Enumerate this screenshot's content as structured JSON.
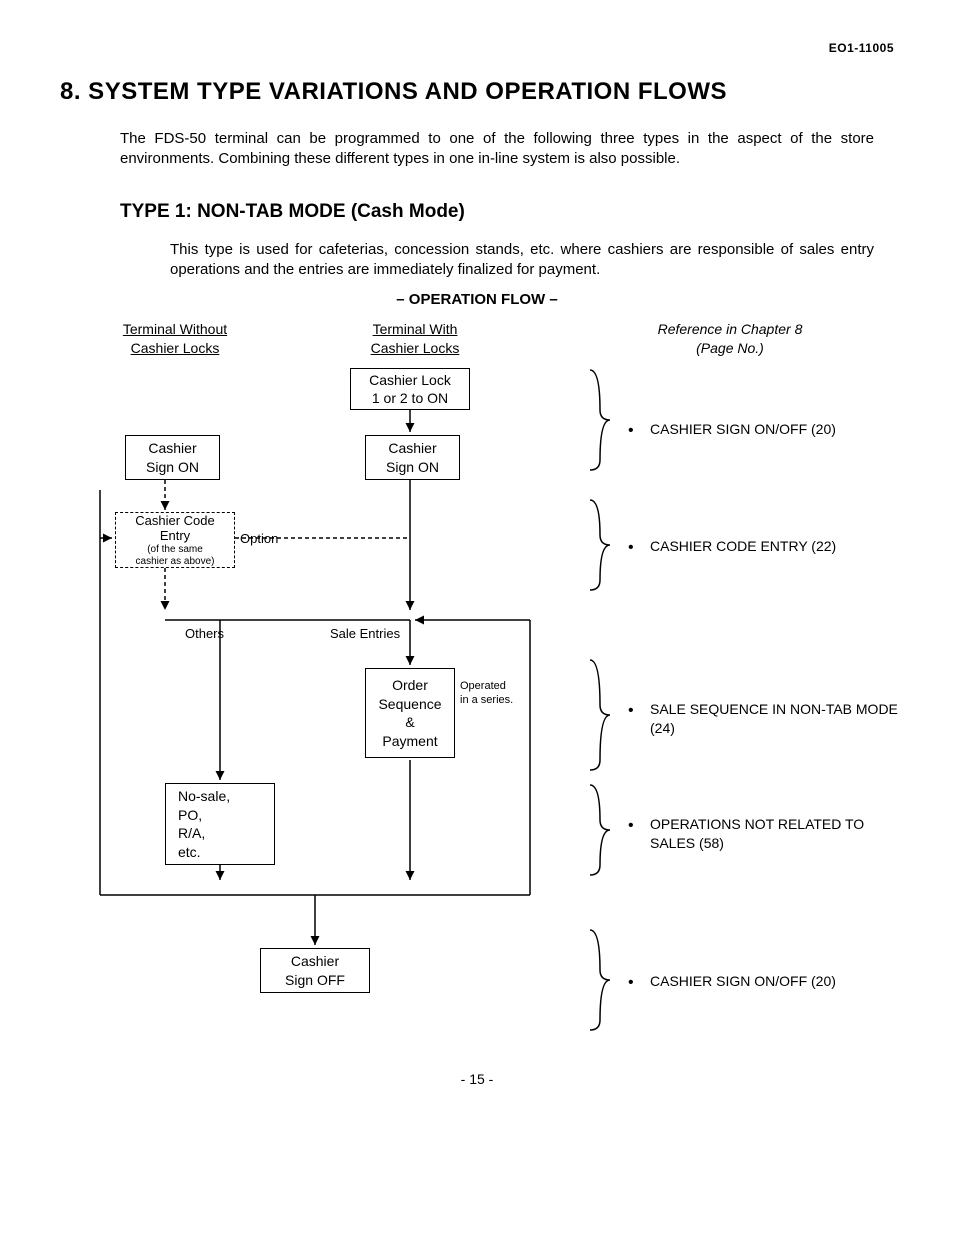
{
  "doc_id": "EO1-11005",
  "heading": "8.  SYSTEM TYPE VARIATIONS AND OPERATION FLOWS",
  "intro": "The FDS-50 terminal can be programmed to one of the following three types in the aspect of the store environments. Combining these different types in one in-line system is also possible.",
  "type1_heading": "TYPE 1:  NON-TAB MODE (Cash Mode)",
  "type1_desc": "This type is used for cafeterias, concession stands, etc. where cashiers are responsible of sales entry operations and the entries are immediately finalized for payment.",
  "opflow_label": "– OPERATION FLOW –",
  "columns": {
    "without": "Terminal Without\nCashier Locks",
    "with": "Terminal With\nCashier Locks",
    "ref": "Reference in Chapter 8\n(Page No.)"
  },
  "boxes": {
    "lock": "Cashier Lock\n1 or 2 to ON",
    "signon_a": "Cashier\nSign ON",
    "signon_b": "Cashier\nSign ON",
    "code_entry_main": "Cashier Code\nEntry",
    "code_entry_sub": "(of the same\ncashier as above)",
    "order": "Order\nSequence\n&\nPayment",
    "nosale": "No-sale,\nPO,\nR/A,\netc.",
    "signoff": "Cashier\nSign OFF"
  },
  "labels": {
    "option": "Option",
    "others": "Others",
    "sale_entries": "Sale Entries",
    "operated": "Operated\nin a series."
  },
  "refs": {
    "r1": "CASHIER SIGN ON/OFF (20)",
    "r2": "CASHIER CODE ENTRY (22)",
    "r3": "SALE SEQUENCE IN NON-TAB MODE (24)",
    "r4": "OPERATIONS NOT RELATED TO SALES (58)",
    "r5": "CASHIER SIGN ON/OFF (20)"
  },
  "page_num": "- 15 -"
}
